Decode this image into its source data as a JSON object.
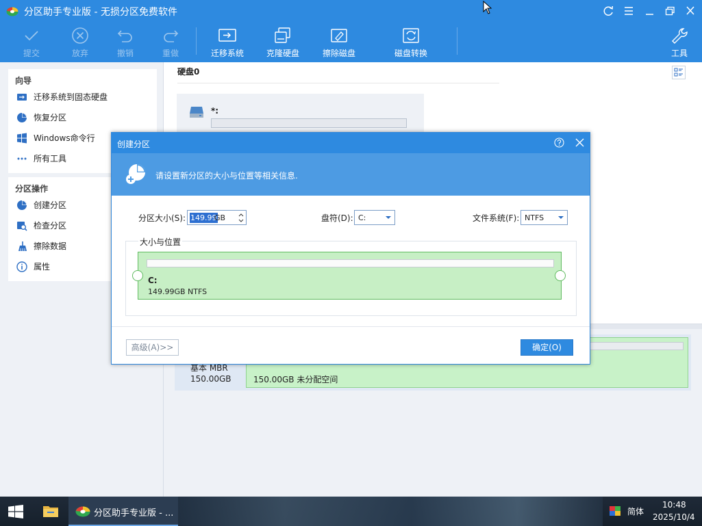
{
  "app": {
    "title": "分区助手专业版 - 无损分区免费软件"
  },
  "toolbar": {
    "submit": "提交",
    "discard": "放弃",
    "undo": "撤销",
    "redo": "重做",
    "migrate_os": "迁移系统",
    "clone_disk": "克隆硬盘",
    "wipe_disk": "擦除磁盘",
    "disk_convert": "磁盘转换",
    "tools": "工具"
  },
  "sidebar": {
    "wizard_title": "向导",
    "wizard_items": [
      {
        "label": "迁移系统到固态硬盘",
        "icon": "migrate-icon"
      },
      {
        "label": "恢复分区",
        "icon": "pie-chart-icon"
      },
      {
        "label": "Windows命令行",
        "icon": "windows-icon"
      },
      {
        "label": "所有工具",
        "icon": "more-icon"
      }
    ],
    "ops_title": "分区操作",
    "ops_items": [
      {
        "label": "创建分区",
        "icon": "pie-chart-icon"
      },
      {
        "label": "检查分区",
        "icon": "search-icon"
      },
      {
        "label": "擦除数据",
        "icon": "broom-icon"
      },
      {
        "label": "属性",
        "icon": "info-icon"
      }
    ]
  },
  "main": {
    "disk_title": "硬盘0",
    "disk_card_label": "*:",
    "disk_row_type": "基本 MBR",
    "disk_row_size": "150.00GB",
    "disk_row_partition": "150.00GB 未分配空间"
  },
  "dialog": {
    "title": "创建分区",
    "banner": "请设置新分区的大小与位置等相关信息.",
    "size_label": "分区大小(S):",
    "size_value": "149.99",
    "size_unit": "GB",
    "drive_letter_label": "盘符(D):",
    "drive_letter_value": "C:",
    "filesystem_label": "文件系统(F):",
    "filesystem_value": "NTFS",
    "group_label": "大小与位置",
    "partition_name": "C:",
    "partition_info": "149.99GB NTFS",
    "advanced_button": "高级(A)>>",
    "ok_button": "确定(O)"
  },
  "taskbar": {
    "app_label": "分区助手专业版 - ...",
    "ime": "简体",
    "time": "10:48",
    "date": "2025/10/4"
  },
  "colors": {
    "accent": "#2e8ae0",
    "partition_green": "#c7efc5",
    "banner": "#4d9be3"
  }
}
